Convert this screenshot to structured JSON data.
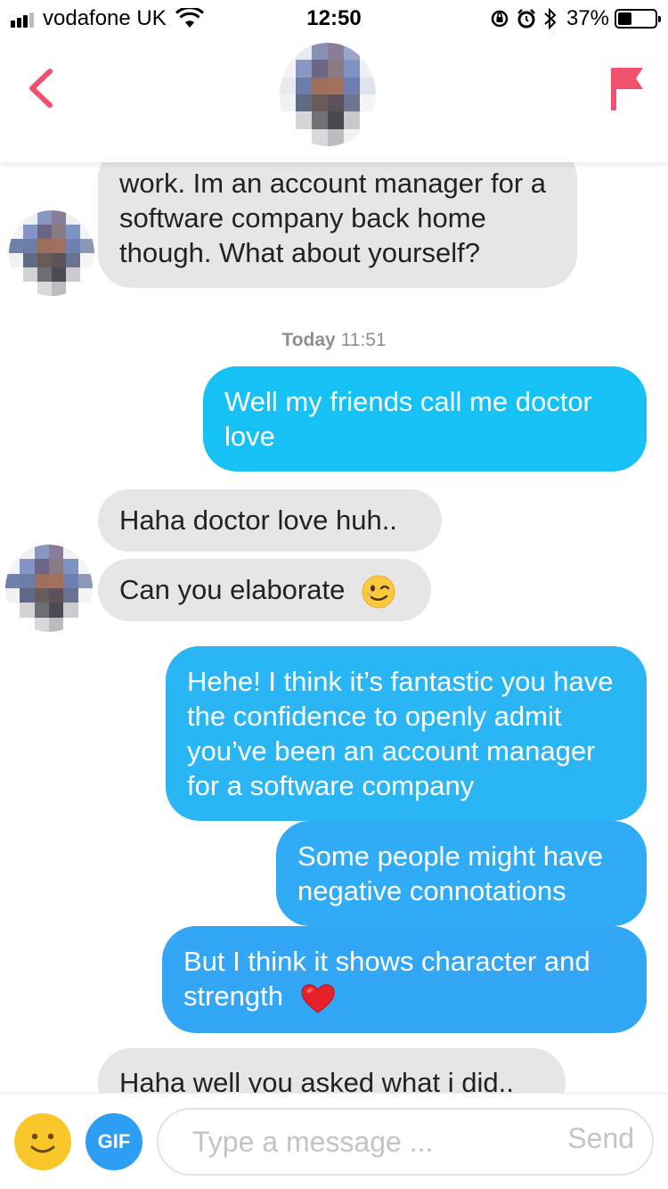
{
  "status_bar": {
    "carrier": "vodafone UK",
    "time": "12:50",
    "battery": "37%",
    "battery_level": 0.37,
    "icons": [
      "signal-icon",
      "wifi-icon",
      "orientation-lock-icon",
      "alarm-icon",
      "bluetooth-icon",
      "battery-icon"
    ]
  },
  "header": {
    "back_icon": "chevron-left-icon",
    "report_icon": "flag-icon",
    "accent_color": "#f2506c"
  },
  "messages": {
    "m1": "work. Im an account manager for a software company back home though. What about yourself?",
    "ts_day": "Today",
    "ts_time": "11:51",
    "m2": "Well my friends call me doctor love",
    "m3": "Haha doctor love huh..",
    "m4": "Can you elaborate",
    "m5": "Hehe! I think it’s fantastic you have the confidence to openly admit you’ve been an account manager for a software company",
    "m6": "Some people might have negative connotations",
    "m7": "But I think it shows character and strength",
    "m8": "Haha well you asked what i did.."
  },
  "composer": {
    "gif_label": "GIF",
    "placeholder": "Type a message ...",
    "send_label": "Send"
  },
  "colors": {
    "incoming_bubble": "#e6e6e6",
    "outgoing_bubble_1": "#16c2f5",
    "outgoing_bubble_4": "#34a6f6",
    "gif_button": "#2d9ef3",
    "emoji_button": "#f9c72a"
  }
}
